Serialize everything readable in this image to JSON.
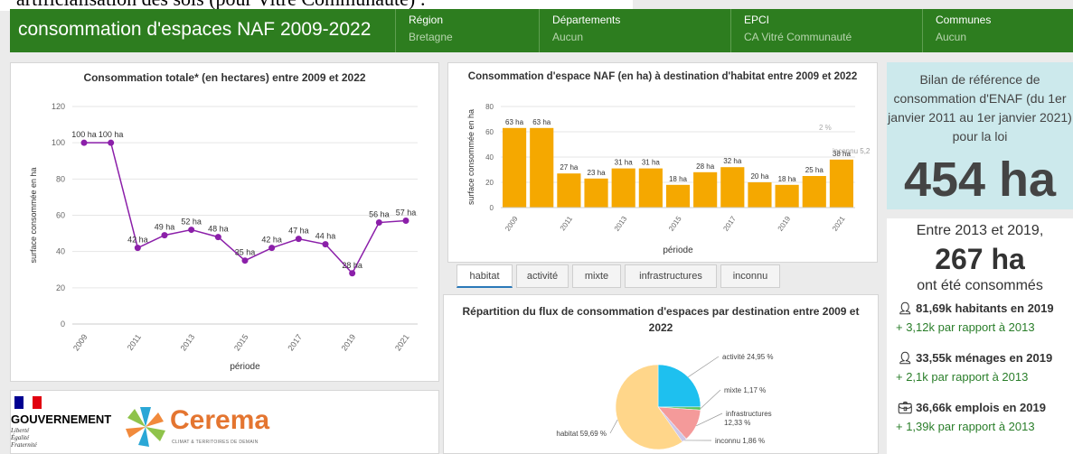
{
  "top_caption": "artificialisation des sols (pour Vitré Communauté) :",
  "header": {
    "title": "consommation d'espaces NAF 2009-2022",
    "filters": [
      {
        "label": "Région",
        "value": "Bretagne"
      },
      {
        "label": "Départements",
        "value": "Aucun"
      },
      {
        "label": "EPCI",
        "value": "CA Vitré Communauté"
      },
      {
        "label": "Communes",
        "value": "Aucun"
      }
    ]
  },
  "colors": {
    "header": "#2d7d1f",
    "line": "#8b1fa9",
    "bar": "#f5a800",
    "card": "#cce9ec"
  },
  "chart_data": [
    {
      "type": "line",
      "title": "Consommation totale* (en hectares) entre 2009 et 2022",
      "xlabel": "période",
      "ylabel": "surface consommée en ha",
      "x": [
        2009,
        2010,
        2011,
        2012,
        2013,
        2014,
        2015,
        2016,
        2017,
        2018,
        2019,
        2020,
        2021
      ],
      "values": [
        100,
        100,
        42,
        49,
        52,
        48,
        35,
        42,
        47,
        44,
        28,
        56,
        57
      ],
      "data_labels": [
        "100 ha",
        "100 ha",
        "42 ha",
        "49 ha",
        "52 ha",
        "48 ha",
        "35 ha",
        "42 ha",
        "47 ha",
        "44 ha",
        "28 ha",
        "56 ha",
        "57 ha"
      ],
      "ylim": [
        0,
        120
      ],
      "yticks": [
        "0",
        "20",
        "40",
        "60",
        "80",
        "100",
        "120"
      ],
      "xticks": [
        "2009",
        "2011",
        "2013",
        "2015",
        "2017",
        "2019",
        "2021"
      ]
    },
    {
      "type": "bar",
      "title": "Consommation d'espace NAF (en ha) à destination d'habitat entre 2009 et 2022",
      "xlabel": "période",
      "ylabel": "surface consommée en ha",
      "categories": [
        "2009",
        "2010",
        "2011",
        "2012",
        "2013",
        "2014",
        "2015",
        "2016",
        "2017",
        "2018",
        "2019",
        "2020",
        "2021"
      ],
      "values": [
        63,
        63,
        27,
        23,
        31,
        31,
        18,
        28,
        32,
        20,
        18,
        25,
        38
      ],
      "data_labels": [
        "63 ha",
        "63 ha",
        "27 ha",
        "23 ha",
        "31 ha",
        "31 ha",
        "18 ha",
        "28 ha",
        "32 ha",
        "20 ha",
        "18 ha",
        "25 ha",
        "38 ha"
      ],
      "ylim": [
        0,
        80
      ],
      "yticks": [
        "0",
        "20",
        "40",
        "60",
        "80"
      ],
      "xticks": [
        "2009",
        "2011",
        "2013",
        "2015",
        "2017",
        "2019",
        "2021"
      ],
      "annotations": [
        "2 %",
        "inconnu 5,2"
      ]
    },
    {
      "type": "pie",
      "title": "Répartition du flux de consommation d'espaces par destination entre 2009 et 2022",
      "slices": [
        {
          "name": "habitat",
          "value": 59.69,
          "label": "habitat 59,69 %",
          "color": "#ffd68a"
        },
        {
          "name": "activité",
          "value": 24.95,
          "label": "activité 24,95 %",
          "color": "#1ec0ef"
        },
        {
          "name": "mixte",
          "value": 1.17,
          "label": "mixte 1,17 %",
          "color": "#57c45a"
        },
        {
          "name": "infrastructures",
          "value": 12.33,
          "label": "infrastructures 12,33 %",
          "color": "#f49a9a"
        },
        {
          "name": "inconnu",
          "value": 1.86,
          "label": "inconnu 1,86 %",
          "color": "#cfc8e8"
        }
      ]
    }
  ],
  "tabs": [
    "habitat",
    "activité",
    "mixte",
    "infrastructures",
    "inconnu"
  ],
  "tabs_active": "habitat",
  "bilan": {
    "heading": "Bilan de référence de consommation d'ENAF (du 1er janvier 2011 au 1er janvier 2021) pour la loi",
    "value": "454 ha"
  },
  "stats": {
    "period_line": "Entre 2013 et 2019,",
    "value": "267 ha",
    "caption": "ont été consommés",
    "rows": [
      {
        "icon": "person-icon",
        "main": "81,69k habitants en 2019",
        "delta": "+ 3,12k par rapport à 2013"
      },
      {
        "icon": "person-icon",
        "main": "33,55k ménages en 2019",
        "delta": "+ 2,1k par rapport à 2013"
      },
      {
        "icon": "briefcase-icon",
        "main": "36,66k emplois en 2019",
        "delta": "+ 1,39k par rapport à 2013"
      }
    ]
  },
  "logos": {
    "gov_name": "GOUVERNEMENT",
    "gov_motto": [
      "Liberté",
      "Égalité",
      "Fraternité"
    ],
    "cerema_name": "Cerema",
    "cerema_tagline": "CLIMAT & TERRITOIRES DE DEMAIN"
  }
}
